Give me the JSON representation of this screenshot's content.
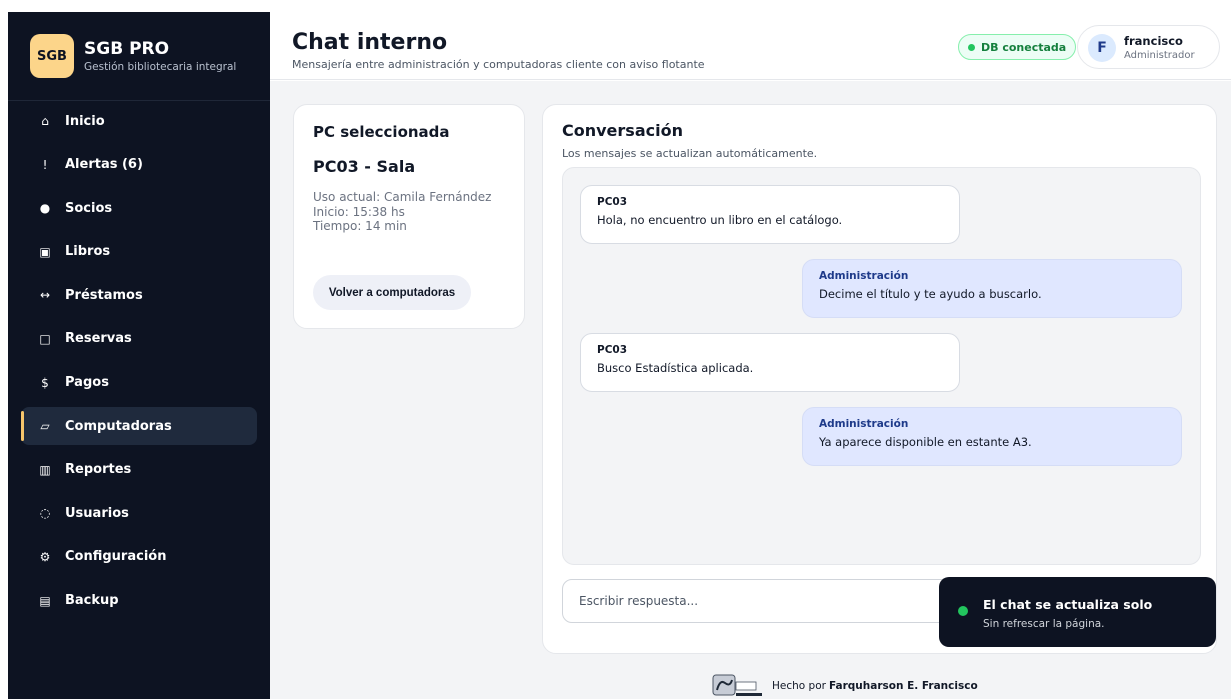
{
  "brand": {
    "logo": "SGB",
    "name": "SGB PRO",
    "subtitle": "Gestión bibliotecaria integral"
  },
  "sidebar": {
    "items": [
      {
        "icon": "⌂",
        "icon_name": "home-icon",
        "label": "Inicio"
      },
      {
        "icon": "!",
        "icon_name": "alert-icon",
        "label": "Alertas (6)"
      },
      {
        "icon": "●",
        "icon_name": "members-icon",
        "label": "Socios"
      },
      {
        "icon": "▣",
        "icon_name": "book-icon",
        "label": "Libros"
      },
      {
        "icon": "↔",
        "icon_name": "loan-icon",
        "label": "Préstamos"
      },
      {
        "icon": "□",
        "icon_name": "reservation-icon",
        "label": "Reservas"
      },
      {
        "icon": "$",
        "icon_name": "dollar-icon",
        "label": "Pagos"
      },
      {
        "icon": "▱",
        "icon_name": "computer-icon",
        "label": "Computadoras"
      },
      {
        "icon": "▥",
        "icon_name": "reports-icon",
        "label": "Reportes"
      },
      {
        "icon": "◌",
        "icon_name": "users-icon",
        "label": "Usuarios"
      },
      {
        "icon": "⚙",
        "icon_name": "gear-icon",
        "label": "Configuración"
      },
      {
        "icon": "▤",
        "icon_name": "backup-icon",
        "label": "Backup"
      }
    ],
    "active": "Computadoras"
  },
  "header": {
    "title": "Chat interno",
    "subtitle": "Mensajería entre administración y computadoras cliente con aviso flotante",
    "db_status": "DB conectada",
    "user": {
      "initial": "F",
      "name": "francisco",
      "role": "Administrador"
    }
  },
  "pc_panel": {
    "heading": "PC seleccionada",
    "pc_name": "PC03 - Sala",
    "usage": "Uso actual: Camila Fernández",
    "start": "Inicio: 15:38 hs",
    "time": "Tiempo: 14 min",
    "back_button": "Volver a computadoras"
  },
  "chat": {
    "heading": "Conversación",
    "subtitle": "Los mensajes se actualizan automáticamente.",
    "messages": [
      {
        "author": "PC03",
        "text": "Hola, no encuentro un libro en el catálogo.",
        "side": "pc"
      },
      {
        "author": "Administración",
        "text": "Decime el título y te ayudo a buscarlo.",
        "side": "admin"
      },
      {
        "author": "PC03",
        "text": "Busco Estadística aplicada.",
        "side": "pc"
      },
      {
        "author": "Administración",
        "text": "Ya aparece disponible en estante A3.",
        "side": "admin"
      }
    ],
    "reply_placeholder": "Escribir respuesta..."
  },
  "toast": {
    "title": "El chat se actualiza solo",
    "subtitle": "Sin refrescar la página."
  },
  "footer": {
    "made_by": "Hecho por",
    "author": "Farquharson E. Francisco"
  },
  "colors": {
    "sidebar_bg": "#0d1322",
    "accent": "#f6c56b",
    "success": "#22c55e",
    "admin_bubble": "#e0e7ff"
  }
}
